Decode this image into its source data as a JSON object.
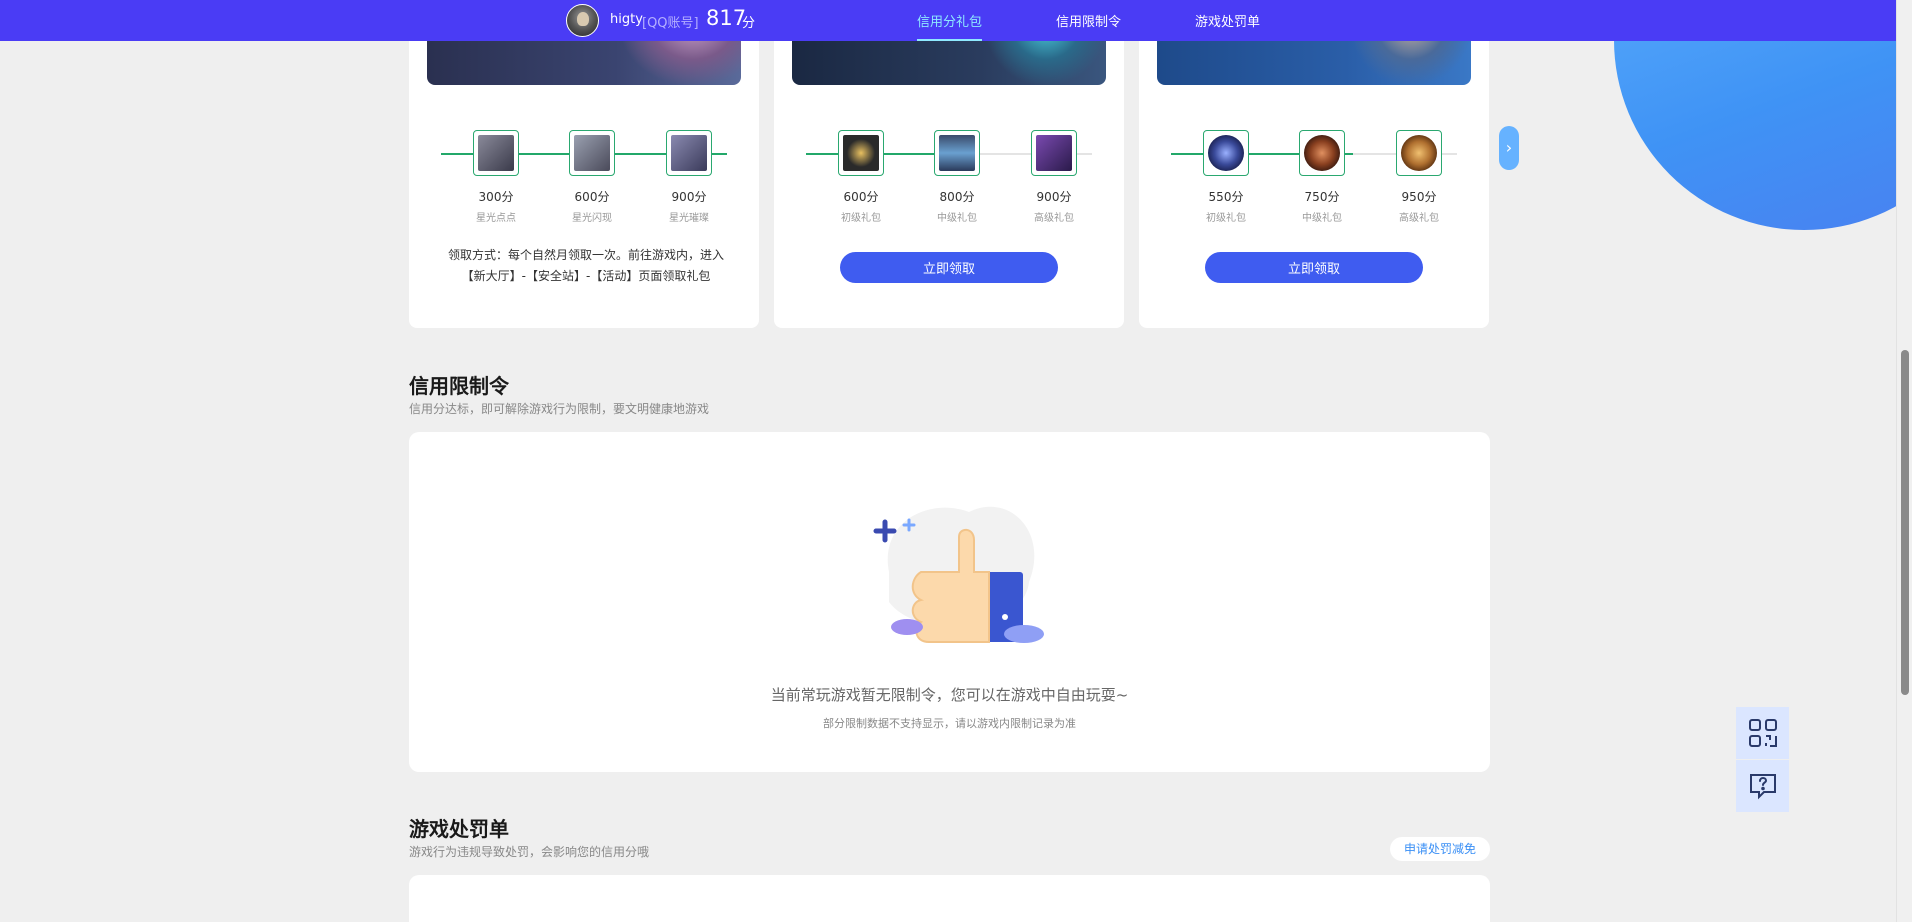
{
  "header": {
    "username": "higty",
    "account_type": "[QQ账号]",
    "score": "817",
    "score_unit": "分",
    "nav": [
      {
        "label": "信用分礼包",
        "active": true
      },
      {
        "label": "信用限制令",
        "active": false
      },
      {
        "label": "游戏处罚单",
        "active": false
      }
    ]
  },
  "gift_cards": [
    {
      "tiers": [
        {
          "points": "300分",
          "name": "星光点点"
        },
        {
          "points": "600分",
          "name": "星光闪现"
        },
        {
          "points": "900分",
          "name": "星光璀璨"
        }
      ],
      "claim_note": "领取方式：每个自然月领取一次。前往游戏内，进入【新大厅】-【安全站】-【活动】页面领取礼包"
    },
    {
      "tiers": [
        {
          "points": "600分",
          "name": "初级礼包"
        },
        {
          "points": "800分",
          "name": "中级礼包"
        },
        {
          "points": "900分",
          "name": "高级礼包"
        }
      ],
      "button_label": "立即领取"
    },
    {
      "tiers": [
        {
          "points": "550分",
          "name": "初级礼包"
        },
        {
          "points": "750分",
          "name": "中级礼包"
        },
        {
          "points": "950分",
          "name": "高级礼包"
        }
      ],
      "button_label": "立即领取"
    }
  ],
  "restriction": {
    "title": "信用限制令",
    "subtitle": "信用分达标，即可解除游戏行为限制，要文明健康地游戏",
    "empty_title": "当前常玩游戏暂无限制令，您可以在游戏中自由玩耍~",
    "empty_note": "部分限制数据不支持显示，请以游戏内限制记录为准"
  },
  "penalty": {
    "title": "游戏处罚单",
    "subtitle": "游戏行为违规导致处罚，会影响您的信用分哦",
    "appeal_label": "申请处罚减免"
  },
  "colors": {
    "topbar": "#4a3cf5",
    "nav_active": "#8fe9ff",
    "primary_button": "#3f5cf0",
    "progress": "#23a86a",
    "side_tool": "#dbe6ff"
  }
}
